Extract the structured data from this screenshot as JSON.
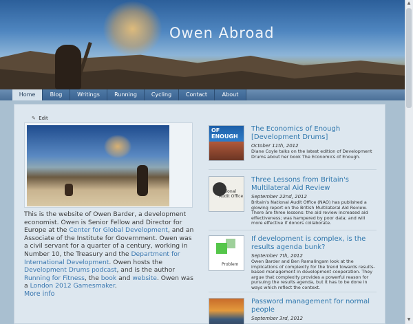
{
  "site": {
    "title": "Owen Abroad"
  },
  "nav": {
    "items": [
      {
        "label": "Home"
      },
      {
        "label": "Blog"
      },
      {
        "label": "Writings"
      },
      {
        "label": "Running"
      },
      {
        "label": "Cycling"
      },
      {
        "label": "Contact"
      },
      {
        "label": "About"
      }
    ]
  },
  "main": {
    "edit_label": "Edit",
    "intro": {
      "p1": "This is the website of Owen Barder, a development economist. Owen is Senior Fellow and Director for Europe at the ",
      "cgd": "Center for Global Development",
      "p2": ", and an Associate of the Institute for Government. Owen was a civil servant for a quarter of a century, working in Number 10, the Treasury and the ",
      "dfid": "Department for International Development",
      "p3": ". Owen hosts the ",
      "podcast": "Development Drums podcast",
      "p4": ", and is the author ",
      "running": "Running for Fitness",
      "p5": ", the ",
      "book": "book",
      "p6": " and ",
      "website": "website",
      "p7": ". Owen was a ",
      "gamesmaker": "London 2012 Gamesmaker",
      "p8": "."
    },
    "more_info": "More info"
  },
  "posts": [
    {
      "title": "The Economics of Enough [Development Drums]",
      "date": "October 11th, 2012",
      "excerpt": "Diane Coyle talks on the latest edition of Development Drums about her book The Economics of Enough.",
      "thumb_text": "OF ENOUGH"
    },
    {
      "title": "Three Lessons from Britain's Multilateral Aid Review",
      "date": "September 22nd, 2012",
      "excerpt": "Britain's National Audit Office (NAO) has published a glowing report on the British Multilateral Aid Review. There are three lessons: the aid review increased aid effectiveness; was hampered by poor data; and will more effective if donors collaborate.",
      "thumb_text": "National Audit Office"
    },
    {
      "title": "If development is complex, is the results agenda bunk?",
      "date": "September 7th, 2012",
      "excerpt": "Owen Barder and Ben Ramalingam look at the implications of complexity for the trend towards results-based management in development cooperation. They argue that complexity provides a powerful reason for pursuing the results agenda, but it has to be done in ways which reflect the context.",
      "thumb_text": "Problem"
    },
    {
      "title": "Password management for normal people",
      "date": "September 3rd, 2012",
      "excerpt": ""
    }
  ]
}
